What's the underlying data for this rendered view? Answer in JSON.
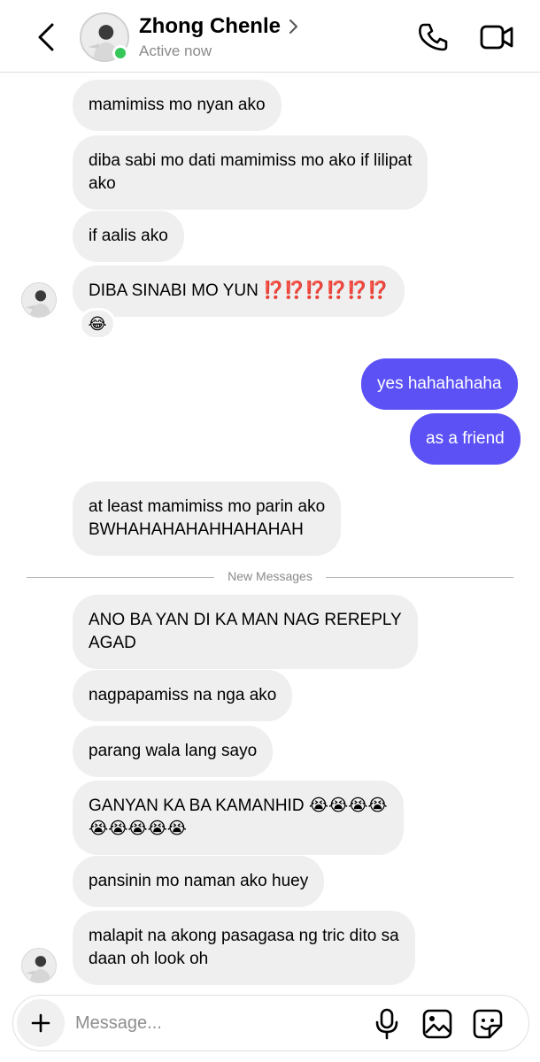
{
  "header": {
    "contact_name": "Zhong Chenle",
    "status": "Active now",
    "icons": [
      "back-arrow-icon",
      "chevron-right-icon",
      "phone-icon",
      "video-camera-icon"
    ]
  },
  "messages": [
    {
      "dir": "in",
      "text": "mamimiss mo nyan ako"
    },
    {
      "dir": "in",
      "text": "diba sabi mo dati mamimiss mo ako if lilipat\nako"
    },
    {
      "dir": "in",
      "text": "if aalis ako"
    },
    {
      "dir": "in",
      "text": "DIBA SINABI MO YUN ⁉️⁉️⁉️⁉️⁉️⁉️",
      "reaction": "😂"
    },
    {
      "dir": "out",
      "text": "yes hahahahaha"
    },
    {
      "dir": "out",
      "text": "as a friend"
    },
    {
      "dir": "in",
      "text": "at least mamimiss mo parin ako\nBWHAHAHAHAHHAHAHAH"
    },
    {
      "dir": "in",
      "text": "ANO BA YAN DI KA MAN NAG REREPLY\nAGAD"
    },
    {
      "dir": "in",
      "text": "nagpapamiss na nga ako"
    },
    {
      "dir": "in",
      "text": "parang wala lang sayo"
    },
    {
      "dir": "in",
      "text": "GANYAN KA BA KAMANHID 😭😭😭😭\n😭😭😭😭😭"
    },
    {
      "dir": "in",
      "text": "pansinin mo naman ako huey"
    },
    {
      "dir": "in",
      "text": "malapit na akong pasagasa ng tric dito sa\ndaan oh look oh"
    }
  ],
  "divider_label": "New Messages",
  "composer": {
    "placeholder": "Message...",
    "icons": [
      "plus-icon",
      "microphone-icon",
      "gallery-icon",
      "sticker-icon"
    ]
  },
  "colors": {
    "outgoing_bubble": "#5b51f5",
    "incoming_bubble": "#efefef",
    "online": "#35c759"
  }
}
